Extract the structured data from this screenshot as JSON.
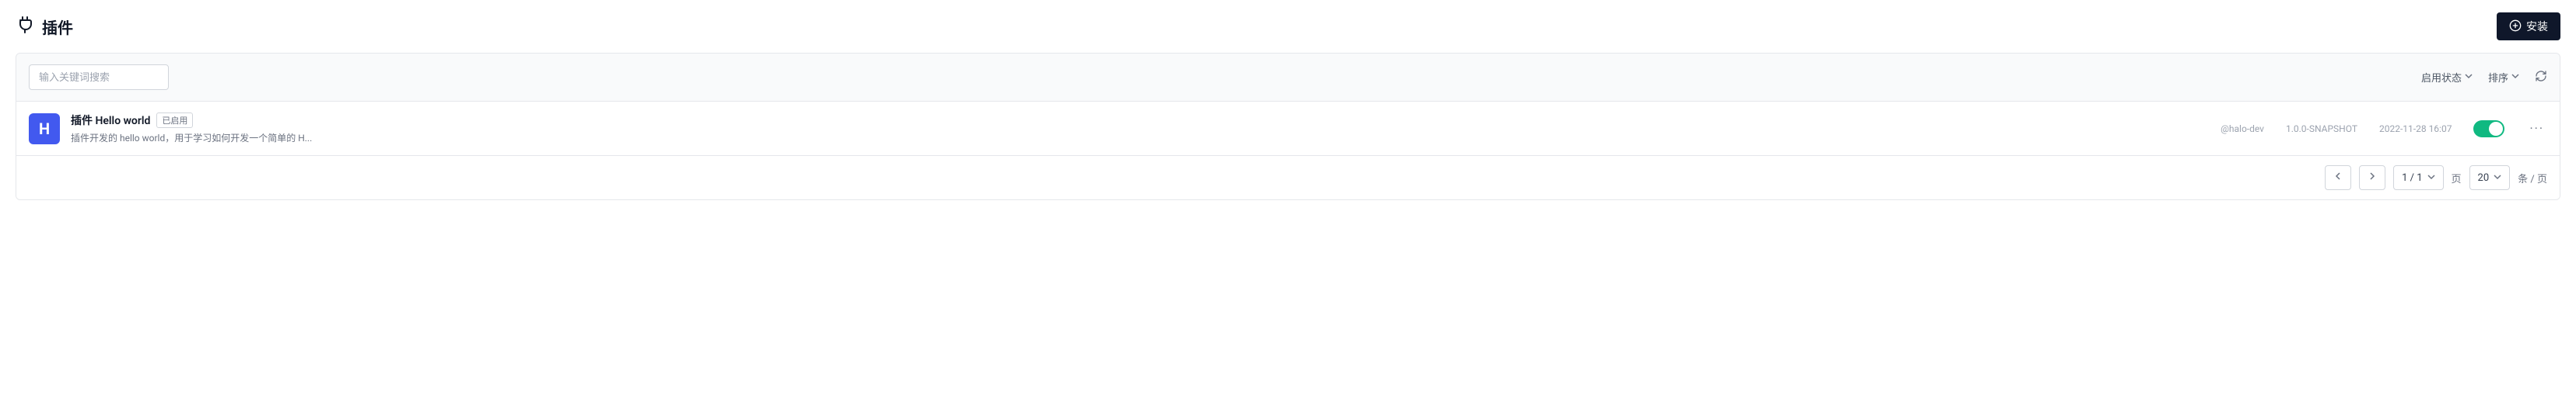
{
  "header": {
    "title": "插件",
    "install_label": "安装"
  },
  "toolbar": {
    "search_placeholder": "输入关键词搜索",
    "filter_status_label": "启用状态",
    "sort_label": "排序"
  },
  "plugins": [
    {
      "icon_letter": "H",
      "title": "插件 Hello world",
      "badge": "已启用",
      "description": "插件开发的 hello world，用于学习如何开发一个简单的 H...",
      "author": "@halo-dev",
      "version": "1.0.0-SNAPSHOT",
      "timestamp": "2022-11-28 16:07",
      "enabled": true
    }
  ],
  "pagination": {
    "current": "1 / 1",
    "page_label": "页",
    "page_size": "20",
    "per_page_label": "条 / 页"
  }
}
